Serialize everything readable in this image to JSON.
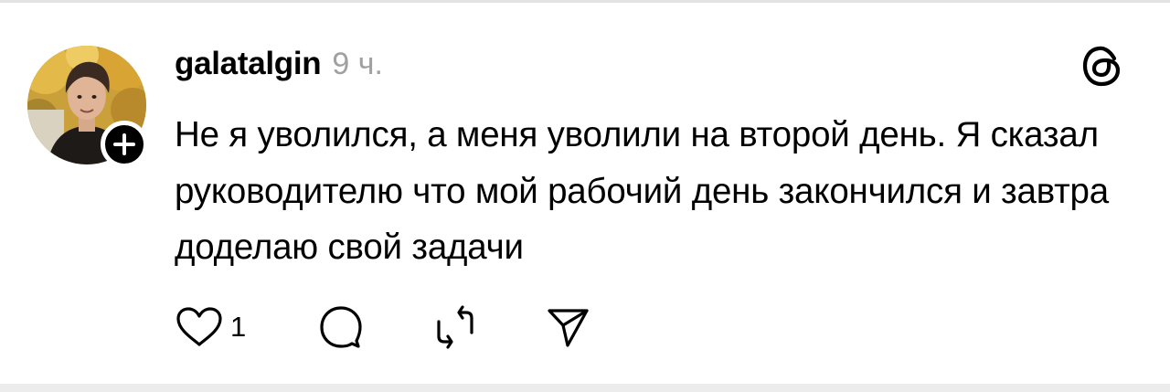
{
  "post": {
    "username": "galatalgin",
    "timestamp": "9 ч.",
    "text": "Не я уволился, а меня уволили на второй день. Я сказал руководителю что мой рабочий день закончился и завтра доделаю свой задачи",
    "likes": "1"
  },
  "icons": {
    "follow": "plus-icon",
    "app": "threads-logo-icon",
    "like": "heart-icon",
    "reply": "comment-bubble-icon",
    "repost": "repost-icon",
    "share": "send-icon"
  },
  "colors": {
    "text": "#000000",
    "timestamp": "#a0a0a0",
    "divider": "#e2e2e2",
    "background": "#ffffff"
  }
}
